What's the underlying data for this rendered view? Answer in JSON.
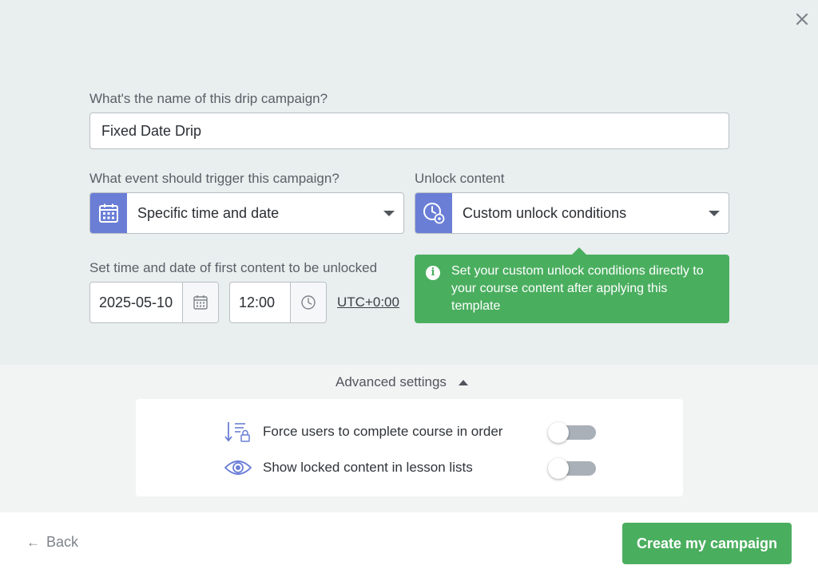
{
  "form": {
    "name_label": "What's the name of this drip campaign?",
    "name_value": "Fixed Date Drip",
    "trigger_label": "What event should trigger this campaign?",
    "trigger_value": "Specific time and date",
    "unlock_label": "Unlock content",
    "unlock_value": "Custom unlock conditions",
    "datetime_label": "Set time and date of first content to be unlocked",
    "date_value": "2025-05-10",
    "time_value": "12:00",
    "timezone": "UTC+0:00"
  },
  "tooltip": {
    "text": "Set your custom unlock conditions directly to your course content after applying this template"
  },
  "advanced": {
    "label": "Advanced settings",
    "options": [
      {
        "label": "Force users to complete course in order",
        "enabled": false,
        "icon": "sort-lock-icon"
      },
      {
        "label": "Show locked content in lesson lists",
        "enabled": false,
        "icon": "eye-icon"
      }
    ]
  },
  "footer": {
    "back_label": "Back",
    "create_label": "Create my campaign"
  },
  "colors": {
    "accent": "#6a7ed6",
    "success": "#4aae5f",
    "background_top": "#e9eeee"
  }
}
